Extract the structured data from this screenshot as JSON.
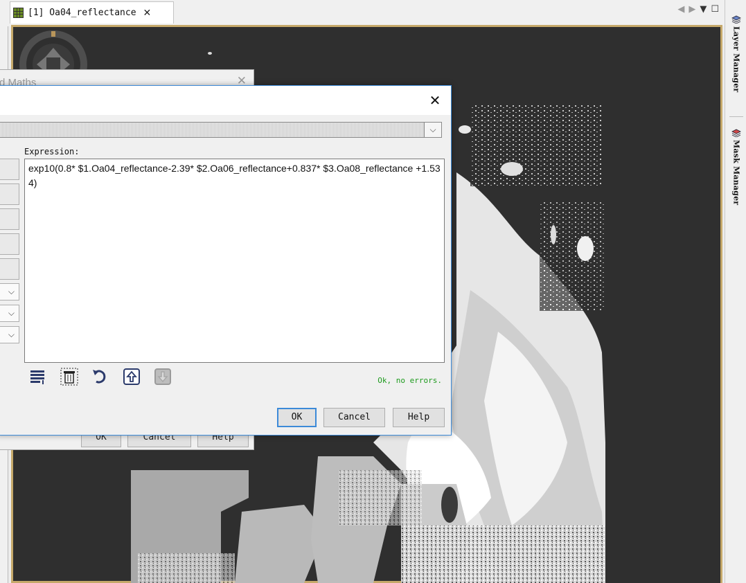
{
  "document_tab": {
    "title": "[1] Oa04_reflectance",
    "icon": "raster-grid-icon",
    "close_glyph": "✕"
  },
  "tab_controls": {
    "prev": "◀",
    "next": "▶",
    "menu": "▼",
    "maximize": "☐"
  },
  "right_tool_windows": [
    {
      "label": "Layer Manager",
      "icon": "layers-icon"
    },
    {
      "label": "Mask Manager",
      "icon": "mask-layers-icon"
    }
  ],
  "background_dialog": {
    "title_fragment": "d Maths",
    "close_glyph": "✕",
    "buttons": {
      "ok": "OK",
      "cancel": "Cancel",
      "help": "Help"
    }
  },
  "expression_dialog": {
    "close_glyph": "✕",
    "combo_arrow": "⌵",
    "expression_label": "Expression:",
    "expression": "exp10(0.8* $1.Oa04_reflectance-2.39* $2.Oa06_reflectance+0.837* $3.Oa08_reflectance +1.534)",
    "status": "Ok, no errors.",
    "toolbar_icons": [
      "history-list-icon",
      "trash-icon",
      "undo-icon",
      "import-expression-icon",
      "export-expression-icon"
    ],
    "buttons": {
      "ok": "OK",
      "cancel": "Cancel",
      "help": "Help"
    }
  },
  "colors": {
    "viewport_border": "#c6a96a",
    "dialog_border": "#3c8ad8",
    "status_ok": "#1d9a1d",
    "image_background": "#2f2f2f"
  }
}
